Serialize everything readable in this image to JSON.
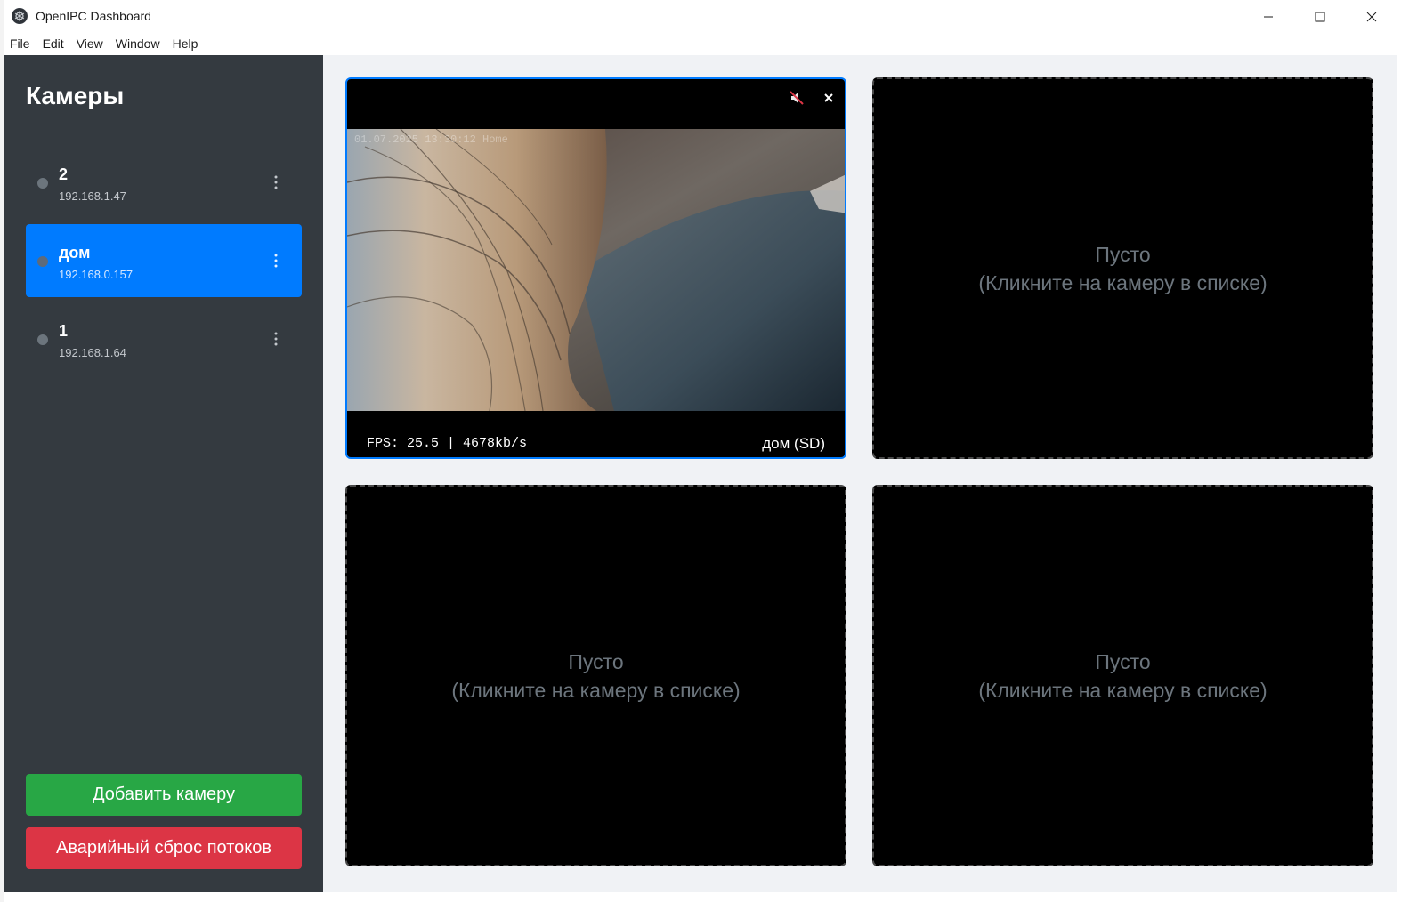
{
  "window": {
    "title": "OpenIPC Dashboard",
    "icon": "openipc-logo-icon",
    "controls": [
      "minimize-icon",
      "maximize-icon",
      "close-icon"
    ]
  },
  "menu": [
    "File",
    "Edit",
    "View",
    "Window",
    "Help"
  ],
  "sidebar": {
    "title": "Камеры",
    "cameras": [
      {
        "name": "2",
        "ip": "192.168.1.47",
        "active": false
      },
      {
        "name": "дом",
        "ip": "192.168.0.157",
        "active": true
      },
      {
        "name": "1",
        "ip": "192.168.1.64",
        "active": false
      }
    ],
    "add_button": "Добавить камеру",
    "reset_button": "Аварийный сброс потоков"
  },
  "grid": {
    "active_tile": {
      "timestamp_overlay": "01.07.2025 13:30:12 Home",
      "stats": "FPS: 25.5 | 4678kb/s",
      "label": "дом (SD)",
      "mute_icon": "speaker-muted-icon",
      "close_icon": "close-icon"
    },
    "empty_tiles": [
      {
        "line1": "Пусто",
        "line2": "(Кликните на камеру в списке)"
      },
      {
        "line1": "Пусто",
        "line2": "(Кликните на камеру в списке)"
      },
      {
        "line1": "Пусто",
        "line2": "(Кликните на камеру в списке)"
      }
    ]
  },
  "colors": {
    "sidebar_bg": "#343a40",
    "accent": "#007bff",
    "add_button": "#28a745",
    "reset_button": "#dc3545",
    "grid_bg": "#f0f2f5"
  }
}
